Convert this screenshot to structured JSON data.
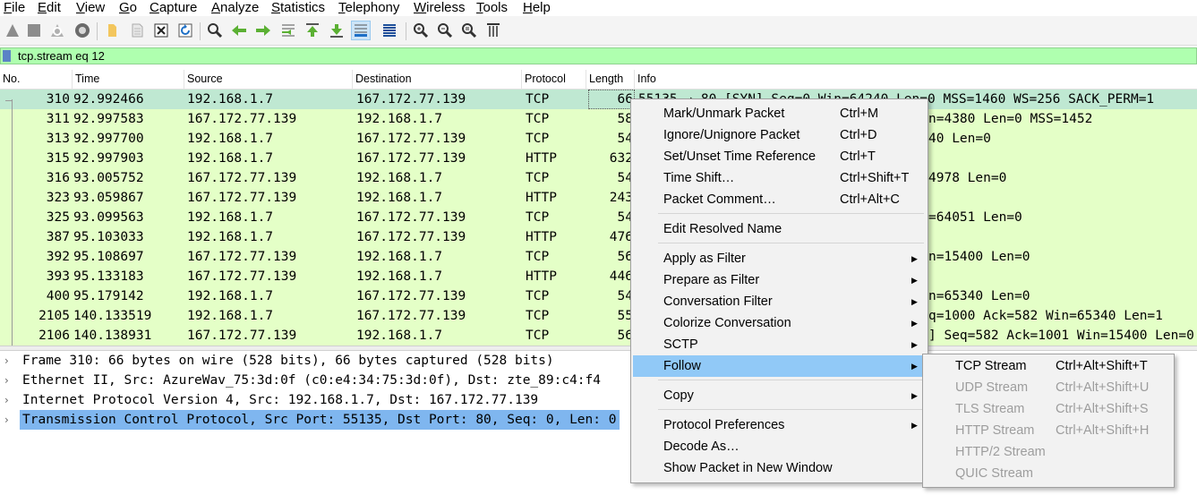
{
  "menu": [
    "File",
    "Edit",
    "View",
    "Go",
    "Capture",
    "Analyze",
    "Statistics",
    "Telephony",
    "Wireless",
    "Tools",
    "Help"
  ],
  "toolbar_icons": [
    "start-capture-icon",
    "stop-capture-icon",
    "restart-capture-icon",
    "capture-options-icon",
    "open-file-icon",
    "save-file-icon",
    "close-file-icon",
    "reload-file-icon",
    "find-packet-icon",
    "go-back-icon",
    "go-forward-icon",
    "go-to-packet-icon",
    "go-first-icon",
    "go-last-icon",
    "autoscroll-icon",
    "colorize-icon",
    "zoom-in-icon",
    "zoom-out-icon",
    "zoom-normal-icon",
    "resize-columns-icon"
  ],
  "filter": {
    "text": "tcp.stream eq 12",
    "background": "#afffaf"
  },
  "columns": [
    "No.",
    "Time",
    "Source",
    "Destination",
    "Protocol",
    "Length",
    "Info"
  ],
  "packets": [
    {
      "no": "310",
      "time": "92.992466",
      "src": "192.168.1.7",
      "dst": "167.172.77.139",
      "proto": "TCP",
      "len": "66",
      "info": "55135 → 80 [SYN] Seq=0 Win=64240 Len=0 MSS=1460 WS=256 SACK_PERM=1"
    },
    {
      "no": "311",
      "time": "92.997583",
      "src": "167.172.77.139",
      "dst": "192.168.1.7",
      "proto": "TCP",
      "len": "58",
      "info": "n=4380 Len=0 MSS=1452"
    },
    {
      "no": "313",
      "time": "92.997700",
      "src": "192.168.1.7",
      "dst": "167.172.77.139",
      "proto": "TCP",
      "len": "54",
      "info": "40 Len=0"
    },
    {
      "no": "315",
      "time": "92.997903",
      "src": "192.168.1.7",
      "dst": "167.172.77.139",
      "proto": "HTTP",
      "len": "632",
      "info": ""
    },
    {
      "no": "316",
      "time": "93.005752",
      "src": "167.172.77.139",
      "dst": "192.168.1.7",
      "proto": "TCP",
      "len": "54",
      "info": "4978 Len=0"
    },
    {
      "no": "323",
      "time": "93.059867",
      "src": "167.172.77.139",
      "dst": "192.168.1.7",
      "proto": "HTTP",
      "len": "243",
      "info": ""
    },
    {
      "no": "325",
      "time": "93.099563",
      "src": "192.168.1.7",
      "dst": "167.172.77.139",
      "proto": "TCP",
      "len": "54",
      "info": "=64051 Len=0"
    },
    {
      "no": "387",
      "time": "95.103033",
      "src": "192.168.1.7",
      "dst": "167.172.77.139",
      "proto": "HTTP",
      "len": "476",
      "info": ""
    },
    {
      "no": "392",
      "time": "95.108697",
      "src": "167.172.77.139",
      "dst": "192.168.1.7",
      "proto": "TCP",
      "len": "56",
      "info": "n=15400 Len=0"
    },
    {
      "no": "393",
      "time": "95.133183",
      "src": "167.172.77.139",
      "dst": "192.168.1.7",
      "proto": "HTTP",
      "len": "446",
      "info": ""
    },
    {
      "no": "400",
      "time": "95.179142",
      "src": "192.168.1.7",
      "dst": "167.172.77.139",
      "proto": "TCP",
      "len": "54",
      "info": "n=65340 Len=0"
    },
    {
      "no": "2105",
      "time": "140.133519",
      "src": "192.168.1.7",
      "dst": "167.172.77.139",
      "proto": "TCP",
      "len": "55",
      "info": "q=1000 Ack=582 Win=65340 Len=1"
    },
    {
      "no": "2106",
      "time": "140.138931",
      "src": "167.172.77.139",
      "dst": "192.168.1.7",
      "proto": "TCP",
      "len": "56",
      "info": "] Seq=582 Ack=1001 Win=15400 Len=0"
    }
  ],
  "details": [
    "Frame 310: 66 bytes on wire (528 bits), 66 bytes captured (528 bits)",
    "Ethernet II, Src: AzureWav_75:3d:0f (c0:e4:34:75:3d:0f), Dst: zte_89:c4:f4",
    "Internet Protocol Version 4, Src: 192.168.1.7, Dst: 167.172.77.139",
    "Transmission Control Protocol, Src Port: 55135, Dst Port: 80, Seq: 0, Len: 0"
  ],
  "context_menu": {
    "items": [
      {
        "label": "Mark/Unmark Packet",
        "shortcut": "Ctrl+M"
      },
      {
        "label": "Ignore/Unignore Packet",
        "shortcut": "Ctrl+D"
      },
      {
        "label": "Set/Unset Time Reference",
        "shortcut": "Ctrl+T"
      },
      {
        "label": "Time Shift…",
        "shortcut": "Ctrl+Shift+T"
      },
      {
        "label": "Packet Comment…",
        "shortcut": "Ctrl+Alt+C"
      },
      {
        "label": "Edit Resolved Name",
        "shortcut": ""
      },
      {
        "label": "Apply as Filter",
        "shortcut": ""
      },
      {
        "label": "Prepare as Filter",
        "shortcut": ""
      },
      {
        "label": "Conversation Filter",
        "shortcut": ""
      },
      {
        "label": "Colorize Conversation",
        "shortcut": ""
      },
      {
        "label": "SCTP",
        "shortcut": ""
      },
      {
        "label": "Follow",
        "shortcut": ""
      },
      {
        "label": "Copy",
        "shortcut": ""
      },
      {
        "label": "Protocol Preferences",
        "shortcut": ""
      },
      {
        "label": "Decode As…",
        "shortcut": ""
      },
      {
        "label": "Show Packet in New Window",
        "shortcut": ""
      }
    ],
    "submenu_arrow": "▶"
  },
  "follow_submenu": [
    {
      "label": "TCP Stream",
      "shortcut": "Ctrl+Alt+Shift+T",
      "enabled": true
    },
    {
      "label": "UDP Stream",
      "shortcut": "Ctrl+Alt+Shift+U",
      "enabled": false
    },
    {
      "label": "TLS Stream",
      "shortcut": "Ctrl+Alt+Shift+S",
      "enabled": false
    },
    {
      "label": "HTTP Stream",
      "shortcut": "Ctrl+Alt+Shift+H",
      "enabled": false
    },
    {
      "label": "HTTP/2 Stream",
      "shortcut": "",
      "enabled": false
    },
    {
      "label": "QUIC Stream",
      "shortcut": "",
      "enabled": false
    }
  ],
  "colors": {
    "tcp_row": "#e4ffc7",
    "selected_row": "#bfe8d2",
    "menu_highlight": "#91c9f7",
    "detail_selected": "#7fb6ef"
  },
  "tree_arrow": "›"
}
